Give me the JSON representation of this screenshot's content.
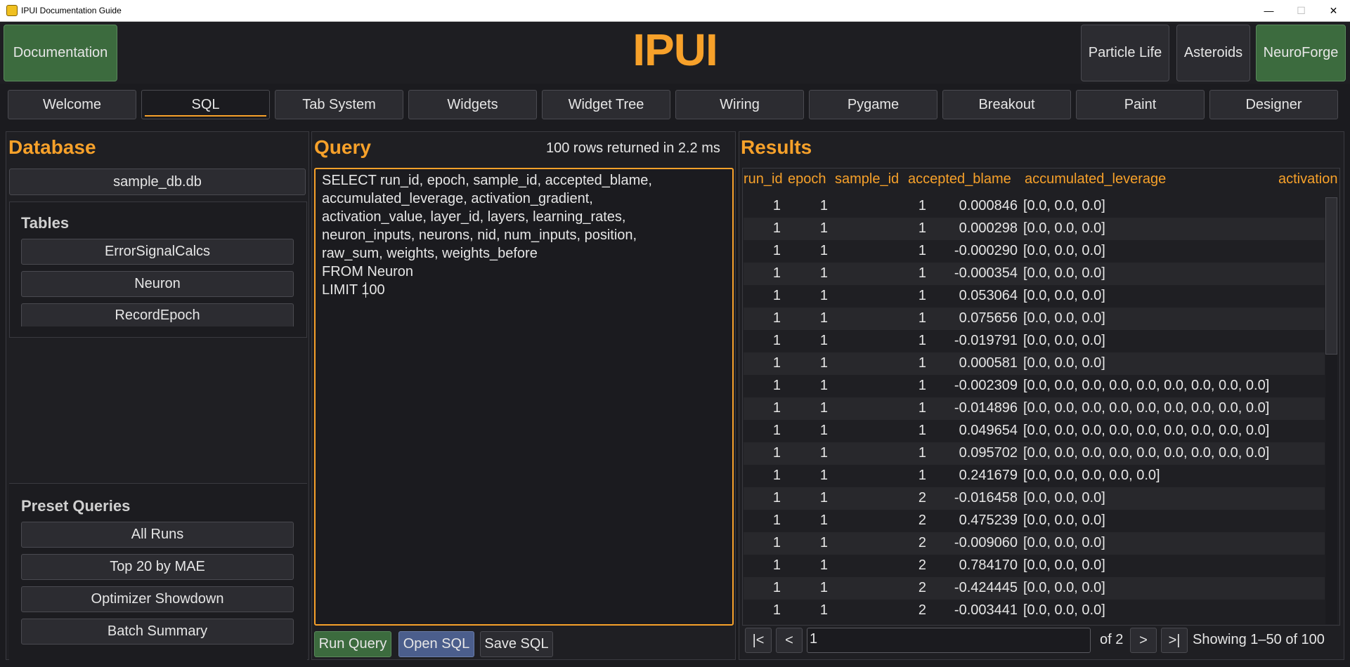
{
  "window": {
    "title": "IPUI Documentation Guide",
    "minimize": "—",
    "maximize": "☐",
    "close": "✕"
  },
  "header": {
    "documentation": "Documentation",
    "logo": "IPUI",
    "particle_life": "Particle Life",
    "asteroids": "Asteroids",
    "neuroforge": "NeuroForge"
  },
  "tabs": [
    "Welcome",
    "SQL",
    "Tab System",
    "Widgets",
    "Widget Tree",
    "Wiring",
    "Pygame",
    "Breakout",
    "Paint",
    "Designer"
  ],
  "active_tab": "SQL",
  "database": {
    "title": "Database",
    "file": "sample_db.db",
    "tables_title": "Tables",
    "tables": [
      "ErrorSignalCalcs",
      "Neuron",
      "RecordEpoch"
    ],
    "presets_title": "Preset Queries",
    "presets": [
      "All Runs",
      "Top 20 by MAE",
      "Optimizer Showdown",
      "Batch Summary"
    ]
  },
  "query": {
    "title": "Query",
    "status": "100 rows returned in 2.2 ms",
    "lines": [
      "SELECT run_id, epoch, sample_id, accepted_blame,",
      "accumulated_leverage, activation_gradient,",
      "activation_value, layer_id, layers, learning_rates,",
      "neuron_inputs, neurons, nid, num_inputs, position,",
      "raw_sum, weights, weights_before",
      "FROM Neuron",
      "LIMIT 100"
    ],
    "run_btn": "Run Query",
    "open_btn": "Open SQL",
    "save_btn": "Save SQL"
  },
  "results": {
    "title": "Results",
    "columns": [
      "run_id",
      "epoch",
      "sample_id",
      "accepted_blame",
      "accumulated_leverage",
      "activation"
    ],
    "rows": [
      [
        "1",
        "1",
        "1",
        "0.000846",
        "[0.0, 0.0, 0.0]"
      ],
      [
        "1",
        "1",
        "1",
        "0.000298",
        "[0.0, 0.0, 0.0]"
      ],
      [
        "1",
        "1",
        "1",
        "-0.000290",
        "[0.0, 0.0, 0.0]"
      ],
      [
        "1",
        "1",
        "1",
        "-0.000354",
        "[0.0, 0.0, 0.0]"
      ],
      [
        "1",
        "1",
        "1",
        "0.053064",
        "[0.0, 0.0, 0.0]"
      ],
      [
        "1",
        "1",
        "1",
        "0.075656",
        "[0.0, 0.0, 0.0]"
      ],
      [
        "1",
        "1",
        "1",
        "-0.019791",
        "[0.0, 0.0, 0.0]"
      ],
      [
        "1",
        "1",
        "1",
        "0.000581",
        "[0.0, 0.0, 0.0]"
      ],
      [
        "1",
        "1",
        "1",
        "-0.002309",
        "[0.0, 0.0, 0.0, 0.0, 0.0, 0.0, 0.0, 0.0, 0.0]"
      ],
      [
        "1",
        "1",
        "1",
        "-0.014896",
        "[0.0, 0.0, 0.0, 0.0, 0.0, 0.0, 0.0, 0.0, 0.0]"
      ],
      [
        "1",
        "1",
        "1",
        "0.049654",
        "[0.0, 0.0, 0.0, 0.0, 0.0, 0.0, 0.0, 0.0, 0.0]"
      ],
      [
        "1",
        "1",
        "1",
        "0.095702",
        "[0.0, 0.0, 0.0, 0.0, 0.0, 0.0, 0.0, 0.0, 0.0]"
      ],
      [
        "1",
        "1",
        "1",
        "0.241679",
        "[0.0, 0.0, 0.0, 0.0, 0.0]"
      ],
      [
        "1",
        "1",
        "2",
        "-0.016458",
        "[0.0, 0.0, 0.0]"
      ],
      [
        "1",
        "1",
        "2",
        "0.475239",
        "[0.0, 0.0, 0.0]"
      ],
      [
        "1",
        "1",
        "2",
        "-0.009060",
        "[0.0, 0.0, 0.0]"
      ],
      [
        "1",
        "1",
        "2",
        "0.784170",
        "[0.0, 0.0, 0.0]"
      ],
      [
        "1",
        "1",
        "2",
        "-0.424445",
        "[0.0, 0.0, 0.0]"
      ],
      [
        "1",
        "1",
        "2",
        "-0.003441",
        "[0.0, 0.0, 0.0]"
      ]
    ],
    "pager": {
      "first": "|<",
      "prev": "<",
      "page": "1",
      "of": "of 2",
      "next": ">",
      "last": ">|",
      "showing": "Showing 1–50 of 100"
    }
  }
}
